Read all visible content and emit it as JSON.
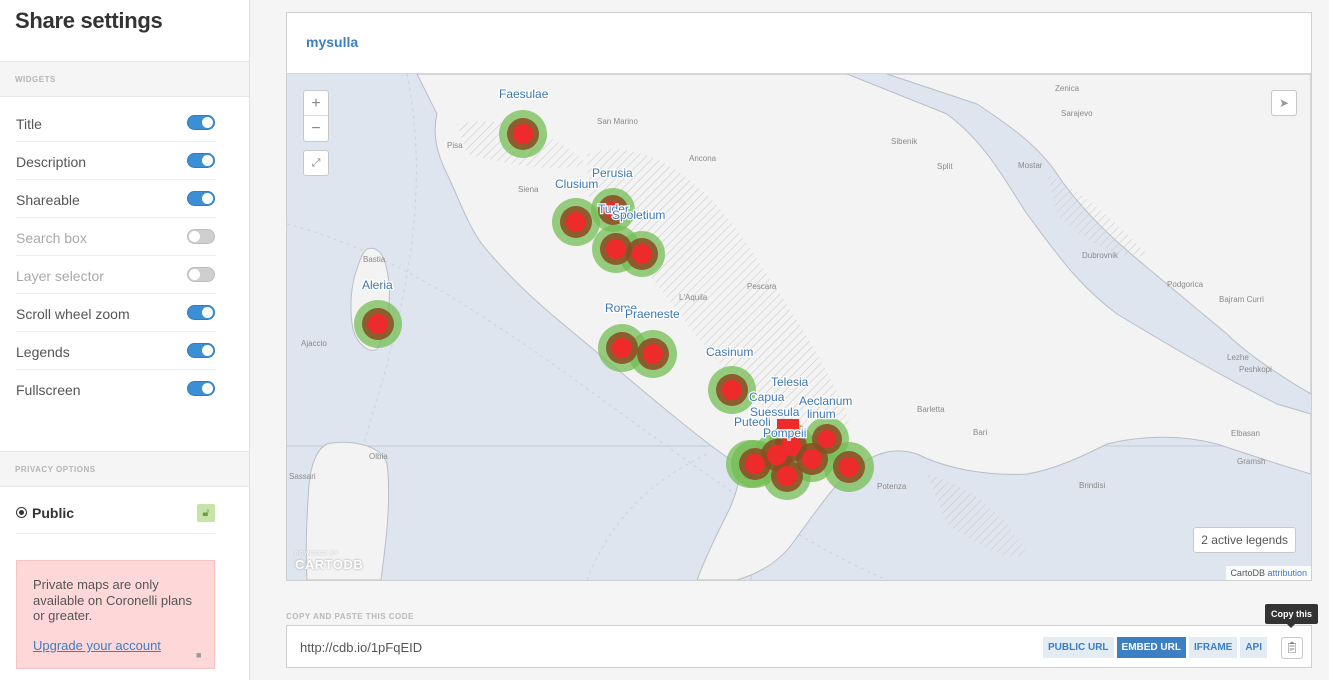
{
  "sidebar": {
    "title": "Share settings",
    "widgets_heading": "WIDGETS",
    "widgets": [
      {
        "label": "Title",
        "enabled": true
      },
      {
        "label": "Description",
        "enabled": true
      },
      {
        "label": "Shareable",
        "enabled": true
      },
      {
        "label": "Search box",
        "enabled": false
      },
      {
        "label": "Layer selector",
        "enabled": false
      },
      {
        "label": "Scroll wheel zoom",
        "enabled": true
      },
      {
        "label": "Legends",
        "enabled": true
      },
      {
        "label": "Fullscreen",
        "enabled": true
      }
    ],
    "privacy_heading": "PRIVACY OPTIONS",
    "privacy_option": "Public",
    "notice_text": "Private maps are only available on Coronelli plans or greater.",
    "upgrade_link": "Upgrade your account"
  },
  "map": {
    "title": "mysulla",
    "zoom_in": "+",
    "zoom_out": "−",
    "legend_button": "2 active legends",
    "attribution_prefix": "CartoDB",
    "attribution_link": "attribution",
    "logo_small": "POWERED BY",
    "logo": "CARTODB",
    "marker_labels": {
      "faesulae": "Faesulae",
      "perusia": "Perusia",
      "clusium": "Clusium",
      "tuder": "Tuder",
      "spoletium": "Spoletium",
      "aleria": "Aleria",
      "rome": "Rome",
      "praeneste": "Praeneste",
      "casinum": "Casinum",
      "telesia": "Telesia",
      "capua": "Capua",
      "suessula": "Suessula",
      "aeclanum": "Aeclanum",
      "puteoli": "Puteoli",
      "pompeii": "Pompeii",
      "nolinum": "linum"
    },
    "place_labels": {
      "sanmarino": "San Marino",
      "ancona": "Ancona",
      "siena": "Siena",
      "pisa": "Pisa",
      "laquila": "L'Aquila",
      "pescara": "Pescara",
      "bastia": "Bastia",
      "ajaccio": "Ajaccio",
      "olbia": "Olbia",
      "sassari": "Sassari",
      "barletta": "Barletta",
      "bari": "Bari",
      "potenza": "Potenza",
      "brindisi": "Brindisi",
      "zenica": "Zenica",
      "sarajevo": "Sarajevo",
      "sibenik": "Sibenik",
      "split": "Split",
      "mostar": "Mostar",
      "dubrovnik": "Dubrovnik",
      "podgorica": "Podgorica",
      "bajramcurri": "Bajram Curri",
      "lezhe": "Lezhe",
      "peshkopi": "Peshkopi",
      "elbasan": "Elbasan",
      "gramsh": "Gramsh"
    }
  },
  "code": {
    "label": "COPY AND PASTE THIS CODE",
    "url": "http://cdb.io/1pFqEID",
    "tabs": [
      "PUBLIC URL",
      "EMBED URL",
      "IFRAME",
      "API"
    ],
    "active_tab": "EMBED URL",
    "tooltip": "Copy this"
  },
  "colors": {
    "accent": "#3c7fc2",
    "marker_core": "#ee2a2a",
    "marker_halo": "#74bd54",
    "notice_bg": "#fed8d8"
  }
}
